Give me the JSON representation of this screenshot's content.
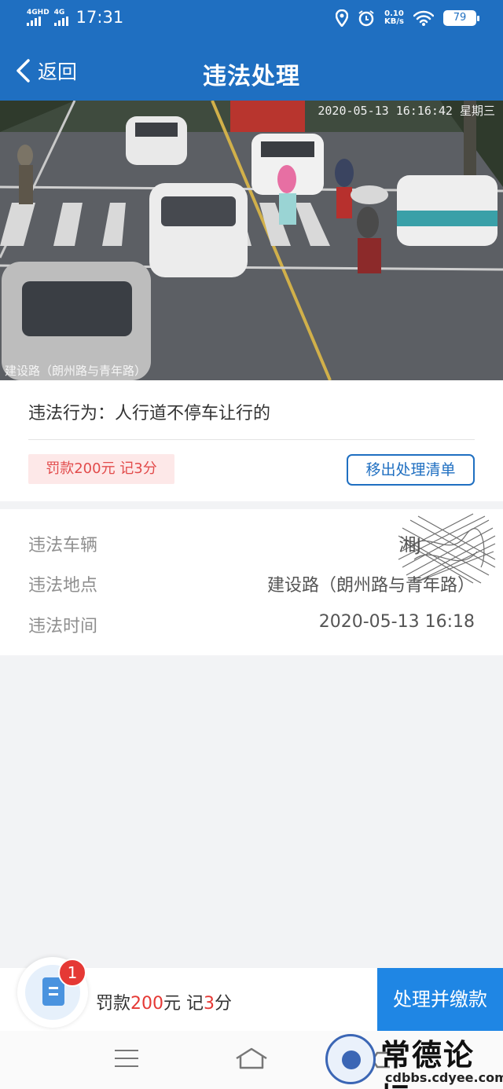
{
  "status_bar": {
    "network_1": "4G",
    "network_1_sup": "HD",
    "network_2": "4G",
    "time": "17:31",
    "speed_value": "0.10",
    "speed_unit": "KB/s",
    "battery": "79",
    "icons": [
      "location-icon",
      "alarm-icon",
      "wifi-icon",
      "battery-icon"
    ]
  },
  "nav": {
    "back_label": "返回",
    "title": "违法处理"
  },
  "photo": {
    "timestamp": "2020-05-13 16:16:42 星期三",
    "location_overlay": "建设路（朗州路与青年路）"
  },
  "violation": {
    "behavior_label": "违法行为：",
    "behavior_value": "人行道不停车让行的",
    "fine_tag": "罚款200元 记3分",
    "remove_button": "移出处理清单"
  },
  "details": [
    {
      "label": "违法车辆",
      "value": "湘J"
    },
    {
      "label": "违法地点",
      "value": "建设路（朗州路与青年路）"
    },
    {
      "label": "违法时间",
      "value": "2020-05-13 16:18"
    }
  ],
  "bottom_bar": {
    "badge_count": "1",
    "summary_prefix": "罚款",
    "fine_amount": "200",
    "summary_mid": "元 记",
    "points": "3",
    "summary_suffix": "分",
    "pay_button": "处理并缴款"
  },
  "watermark": {
    "title": "常德论坛",
    "url": "cdbbs.cdyee.com"
  },
  "colors": {
    "primary": "#1f6fc1",
    "pay_button": "#1f86e4",
    "danger": "#e53935",
    "fine_tag_bg": "#fde8e8"
  }
}
